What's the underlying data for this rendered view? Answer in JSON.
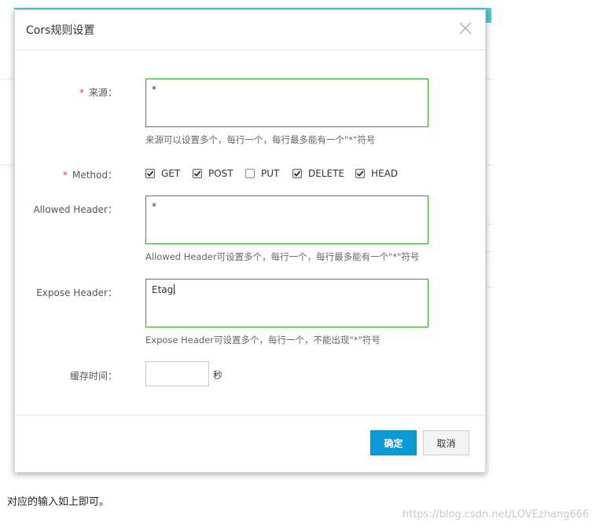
{
  "modal": {
    "title": "Cors规则设置"
  },
  "form": {
    "origin": {
      "label": "来源：",
      "required_mark": "*",
      "value": "*",
      "help": "来源可以设置多个，每行一个，每行最多能有一个\"*\"符号"
    },
    "method": {
      "label": "Method：",
      "required_mark": "*",
      "options": [
        {
          "label": "GET",
          "checked": true
        },
        {
          "label": "POST",
          "checked": true
        },
        {
          "label": "PUT",
          "checked": false
        },
        {
          "label": "DELETE",
          "checked": true
        },
        {
          "label": "HEAD",
          "checked": true
        }
      ]
    },
    "allowed_header": {
      "label": "Allowed Header：",
      "value": "*",
      "help": "Allowed Header可设置多个，每行一个，每行最多能有一个\"*\"符号"
    },
    "expose_header": {
      "label": "Expose Header：",
      "value": "Etag",
      "help": "Expose Header可设置多个，每行一个，不能出现\"*\"符号"
    },
    "cache_time": {
      "label": "缓存时间：",
      "value": "",
      "unit": "秒"
    }
  },
  "footer": {
    "ok_label": "确定",
    "cancel_label": "取消"
  },
  "caption": "对应的输入如上即可。",
  "watermark": "https://blog.csdn.net/LOVEzhang666",
  "colors": {
    "primary_button": "#0a9bd6",
    "field_border_valid": "#2ea121",
    "required": "#e4393c"
  }
}
